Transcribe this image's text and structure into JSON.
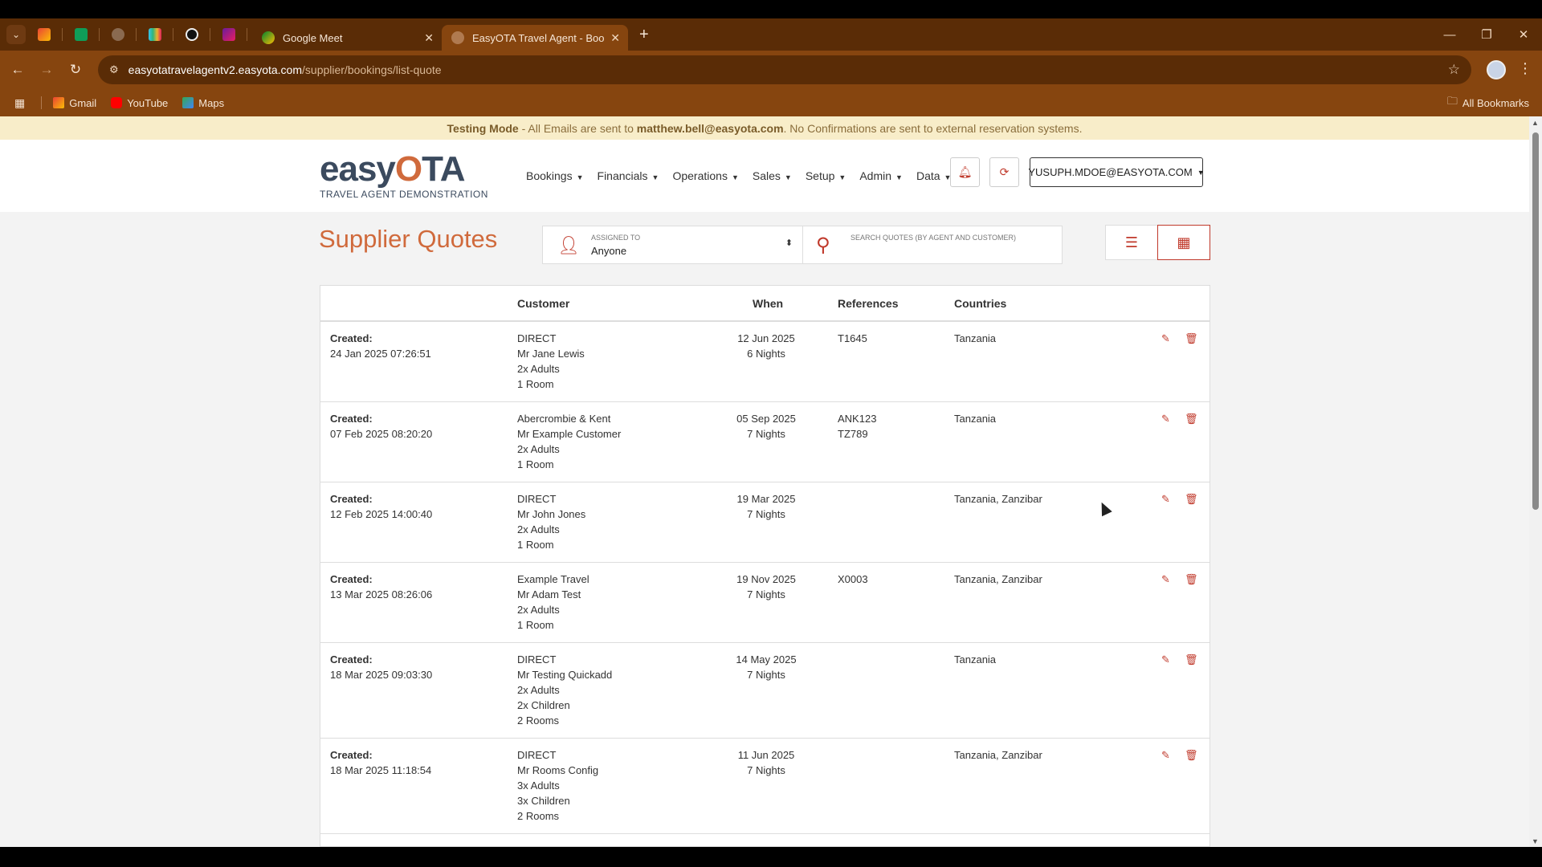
{
  "browser": {
    "tabs": [
      {
        "title": "Google Meet"
      },
      {
        "title": "EasyOTA Travel Agent - Book O"
      }
    ],
    "url_host": "easyotatravelagentv2.easyota.com",
    "url_path": "/supplier/bookings/list-quote",
    "bookmarks": [
      "Gmail",
      "YouTube",
      "Maps"
    ],
    "all_bookmarks": "All Bookmarks"
  },
  "banner": {
    "mode": "Testing Mode",
    "text1": " - All Emails are sent to ",
    "email": "matthew.bell@easyota.com",
    "text2": ". No Confirmations are sent to external reservation systems."
  },
  "header": {
    "logo_word_left": "easy",
    "logo_o": "O",
    "logo_word_right": "TA",
    "logo_sub": "TRAVEL AGENT DEMONSTRATION",
    "menu": [
      "Bookings",
      "Financials",
      "Operations",
      "Sales",
      "Setup",
      "Admin",
      "Data"
    ],
    "user": "YUSUPH.MDOE@EASYOTA.COM"
  },
  "page": {
    "title": "Supplier Quotes",
    "assigned_label": "ASSIGNED TO",
    "assigned_value": "Anyone",
    "search_placeholder": "SEARCH QUOTES (BY AGENT AND CUSTOMER)"
  },
  "table": {
    "headers": {
      "customer": "Customer",
      "when": "When",
      "references": "References",
      "countries": "Countries"
    },
    "created_label": "Created:",
    "rows": [
      {
        "created": "24 Jan 2025 07:26:51",
        "customer": [
          "DIRECT",
          "Mr Jane Lewis",
          "2x Adults",
          "1 Room"
        ],
        "when": [
          "12 Jun 2025",
          "6 Nights"
        ],
        "refs": [
          "T1645"
        ],
        "countries": "Tanzania"
      },
      {
        "created": "07 Feb 2025 08:20:20",
        "customer": [
          "Abercrombie & Kent",
          "Mr Example Customer",
          "2x Adults",
          "1 Room"
        ],
        "when": [
          "05 Sep 2025",
          "7 Nights"
        ],
        "refs": [
          "ANK123",
          "TZ789"
        ],
        "countries": "Tanzania"
      },
      {
        "created": "12 Feb 2025 14:00:40",
        "customer": [
          "DIRECT",
          "Mr John Jones",
          "2x Adults",
          "1 Room"
        ],
        "when": [
          "19 Mar 2025",
          "7 Nights"
        ],
        "refs": [],
        "countries": "Tanzania, Zanzibar"
      },
      {
        "created": "13 Mar 2025 08:26:06",
        "customer": [
          "Example Travel",
          "Mr Adam Test",
          "2x Adults",
          "1 Room"
        ],
        "when": [
          "19 Nov 2025",
          "7 Nights"
        ],
        "refs": [
          "X0003"
        ],
        "countries": "Tanzania, Zanzibar"
      },
      {
        "created": "18 Mar 2025 09:03:30",
        "customer": [
          "DIRECT",
          "Mr Testing Quickadd",
          "2x Adults",
          "2x Children",
          "2 Rooms"
        ],
        "when": [
          "14 May 2025",
          "7 Nights"
        ],
        "refs": [],
        "countries": "Tanzania"
      },
      {
        "created": "18 Mar 2025 11:18:54",
        "customer": [
          "DIRECT",
          "Mr Rooms Config",
          "3x Adults",
          "3x Children",
          "2 Rooms"
        ],
        "when": [
          "11 Jun 2025",
          "7 Nights"
        ],
        "refs": [],
        "countries": "Tanzania, Zanzibar"
      }
    ]
  },
  "colors": {
    "accent": "#d06a3c",
    "danger": "#c0392b",
    "chrome": "#86450f"
  }
}
